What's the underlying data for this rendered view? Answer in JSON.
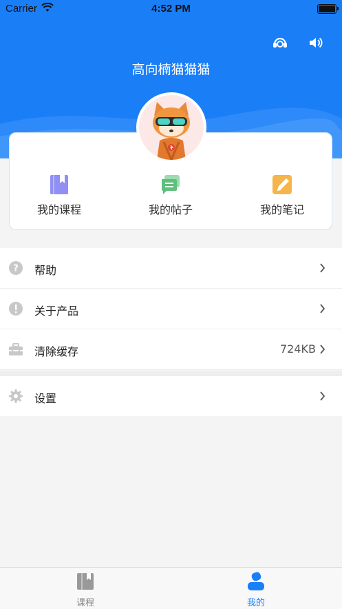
{
  "status_bar": {
    "carrier": "Carrier",
    "time": "4:52 PM"
  },
  "header": {
    "username": "高向楠猫猫猫",
    "icons": [
      "headset-icon",
      "speaker-icon"
    ],
    "background_color": "#1a7ef7"
  },
  "quick_actions": [
    {
      "label": "我的课程",
      "icon": "bookmark-book-icon",
      "color": "#8f8ff5"
    },
    {
      "label": "我的帖子",
      "icon": "chat-bubbles-icon",
      "color": "#5ec07a"
    },
    {
      "label": "我的笔记",
      "icon": "notepad-pen-icon",
      "color": "#f5b54a"
    }
  ],
  "menu": [
    {
      "label": "帮助",
      "icon": "question-icon",
      "value": ""
    },
    {
      "label": "关于产品",
      "icon": "info-exclamation-icon",
      "value": ""
    },
    {
      "label": "清除缓存",
      "icon": "toolbox-icon",
      "value": "724KB"
    },
    {
      "label": "设置",
      "icon": "gear-icon",
      "value": ""
    }
  ],
  "tab_bar": {
    "tabs": [
      {
        "label": "课程",
        "icon": "book-icon",
        "active": false
      },
      {
        "label": "我的",
        "icon": "person-icon",
        "active": true
      }
    ],
    "active_color": "#1a7ef7",
    "inactive_color": "#888888"
  }
}
